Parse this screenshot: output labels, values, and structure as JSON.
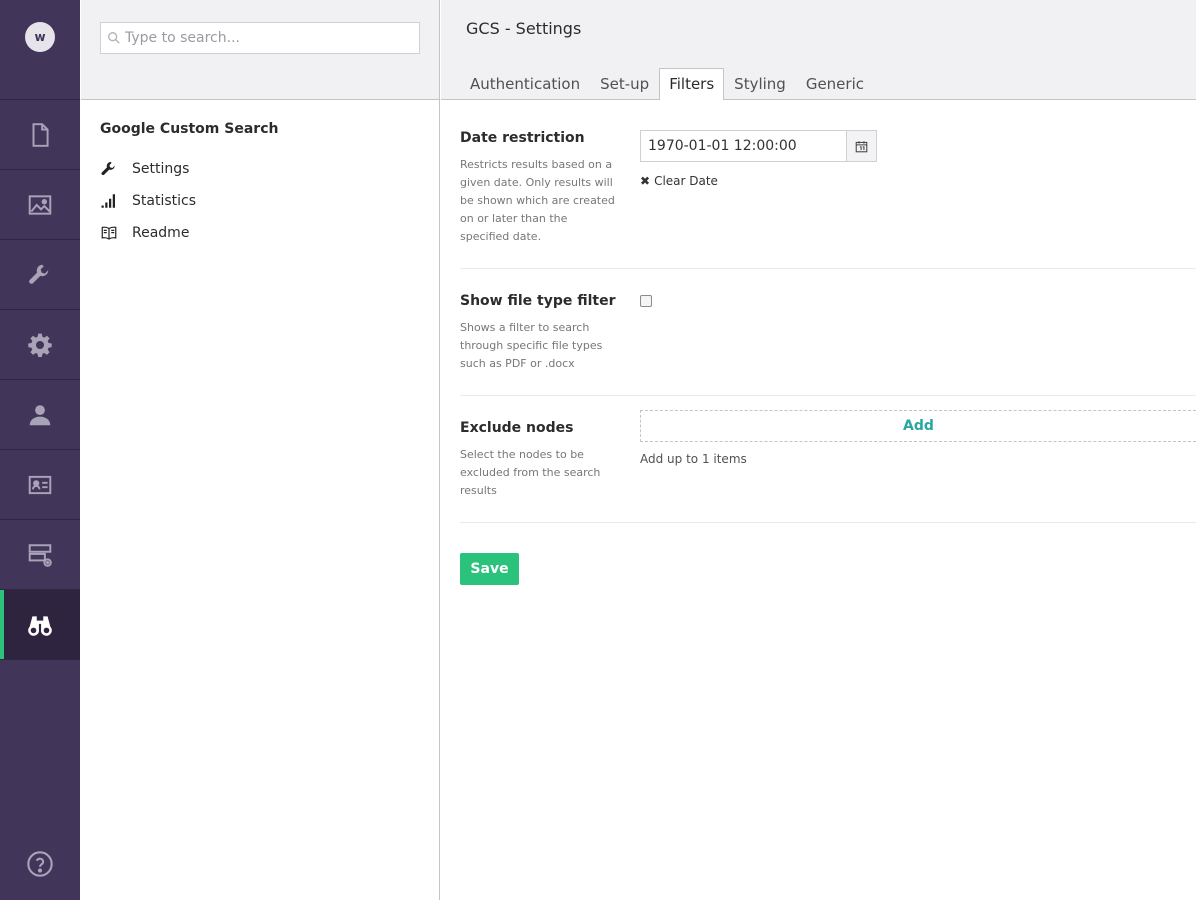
{
  "user": {
    "initial": "w"
  },
  "rail": {
    "items": [
      {
        "name": "content-icon"
      },
      {
        "name": "media-icon"
      },
      {
        "name": "settings-wrench-icon"
      },
      {
        "name": "developer-gear-icon"
      },
      {
        "name": "users-icon"
      },
      {
        "name": "members-icon"
      },
      {
        "name": "forms-icon"
      },
      {
        "name": "binoculars-icon",
        "active": true
      }
    ],
    "help": "help-icon"
  },
  "tree": {
    "search_placeholder": "Type to search...",
    "title": "Google Custom Search",
    "items": [
      {
        "label": "Settings",
        "icon": "wrench-icon"
      },
      {
        "label": "Statistics",
        "icon": "bar-chart-icon"
      },
      {
        "label": "Readme",
        "icon": "book-icon"
      }
    ]
  },
  "main": {
    "title": "GCS - Settings",
    "tabs": [
      {
        "label": "Authentication"
      },
      {
        "label": "Set-up"
      },
      {
        "label": "Filters",
        "active": true
      },
      {
        "label": "Styling"
      },
      {
        "label": "Generic"
      }
    ],
    "props": {
      "date": {
        "label": "Date restriction",
        "desc": "Restricts results based on a given date. Only results will be shown which are created on or later than the specified date.",
        "value": "1970-01-01 12:00:00",
        "clear": "Clear Date"
      },
      "filetype": {
        "label": "Show file type filter",
        "desc": "Shows a filter to search through specific file types such as PDF or .docx",
        "checked": false
      },
      "exclude": {
        "label": "Exclude nodes",
        "desc": "Select the nodes to be excluded from the search results",
        "add": "Add",
        "hint": "Add up to 1 items"
      }
    },
    "save_label": "Save"
  },
  "colors": {
    "rail_bg": "#413659",
    "accent_green": "#2bc37c",
    "link_teal": "#2aa7a0"
  }
}
